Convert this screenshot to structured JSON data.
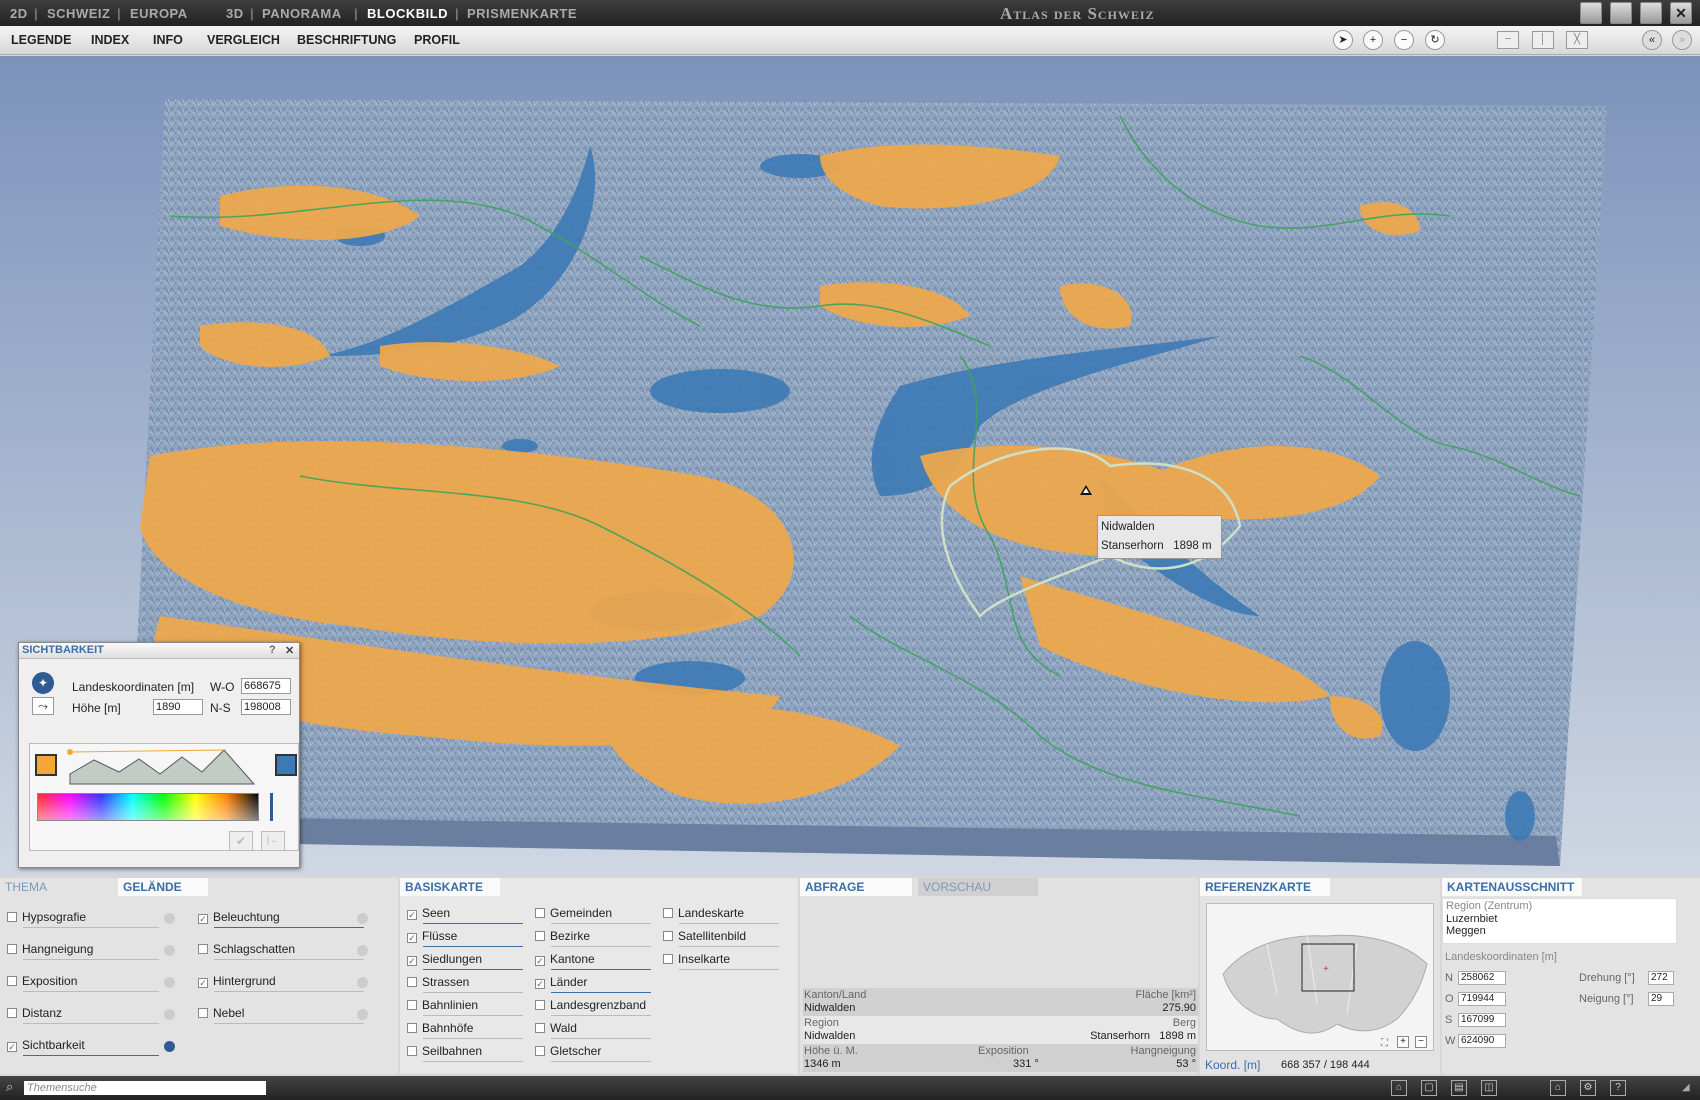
{
  "nav": {
    "t2d": "2D",
    "schweiz": "SCHWEIZ",
    "europa": "EUROPA",
    "t3d": "3D",
    "panorama": "PANORAMA",
    "blockbild": "BLOCKBILD",
    "prismenkarte": "PRISMENKARTE"
  },
  "app_title": "Atlas der Schweiz",
  "menu": {
    "legende": "LEGENDE",
    "index": "INDEX",
    "info": "INFO",
    "vergleich": "VERGLEICH",
    "beschriftung": "BESCHRIFTUNG",
    "profil": "PROFIL"
  },
  "map": {
    "tooltip_region": "Nidwalden",
    "tooltip_peak": "Stanserhorn",
    "tooltip_height": "1898 m"
  },
  "sicht": {
    "title": "SICHTBARKEIT",
    "help": "?",
    "close": "✕",
    "landeskoord_label": "Landeskoordinaten [m]",
    "wo_label": "W-O",
    "wo_value": "668675",
    "hoehe_label": "Höhe [m]",
    "hoehe_value": "1890",
    "ns_label": "N-S",
    "ns_value": "198008",
    "color_visible": "#f4a636",
    "color_hidden": "#3d7ab5"
  },
  "thema": {
    "tab_thema": "THEMA",
    "tab_gelaende": "GELÄNDE",
    "left": [
      {
        "label": "Hypsografie",
        "checked": false
      },
      {
        "label": "Hangneigung",
        "checked": false
      },
      {
        "label": "Exposition",
        "checked": false
      },
      {
        "label": "Distanz",
        "checked": false
      },
      {
        "label": "Sichtbarkeit",
        "checked": true
      }
    ],
    "right": [
      {
        "label": "Beleuchtung",
        "checked": true
      },
      {
        "label": "Schlagschatten",
        "checked": false
      },
      {
        "label": "Hintergrund",
        "checked": true
      },
      {
        "label": "Nebel",
        "checked": false
      }
    ]
  },
  "basis": {
    "title": "BASISKARTE",
    "col1": [
      {
        "label": "Seen",
        "checked": true
      },
      {
        "label": "Flüsse",
        "checked": true
      },
      {
        "label": "Siedlungen",
        "checked": true
      },
      {
        "label": "Strassen",
        "checked": false
      },
      {
        "label": "Bahnlinien",
        "checked": false
      },
      {
        "label": "Bahnhöfe",
        "checked": false
      },
      {
        "label": "Seilbahnen",
        "checked": false
      }
    ],
    "col2": [
      {
        "label": "Gemeinden",
        "checked": false
      },
      {
        "label": "Bezirke",
        "checked": false
      },
      {
        "label": "Kantone",
        "checked": true
      },
      {
        "label": "Länder",
        "checked": true
      },
      {
        "label": "Landesgrenzband",
        "checked": false
      },
      {
        "label": "Wald",
        "checked": false
      },
      {
        "label": "Gletscher",
        "checked": false
      }
    ],
    "col3": [
      {
        "label": "Landeskarte",
        "checked": false
      },
      {
        "label": "Satellitenbild",
        "checked": false
      },
      {
        "label": "Inselkarte",
        "checked": false
      }
    ]
  },
  "abfrage": {
    "tab": "ABFRAGE",
    "tab2": "VORSCHAU",
    "kanton_label": "Kanton/Land",
    "kanton_value": "Nidwalden",
    "flaeche_label": "Fläche [km²]",
    "flaeche_value": "275.90",
    "region_label": "Region",
    "region_value": "Nidwalden",
    "berg_label": "Berg",
    "berg_value": "Stanserhorn",
    "berg_hoehe": "1898 m",
    "hoehe_label": "Höhe ü. M.",
    "hoehe_value": "1346 m",
    "expo_label": "Exposition",
    "expo_value": "331 °",
    "hang_label": "Hangneigung",
    "hang_value": "53 °"
  },
  "referenz": {
    "title": "REFERENZKARTE",
    "koord_label": "Koord. [m]",
    "koord_value": "668 357 / 198 444"
  },
  "ausschnitt": {
    "title": "KARTENAUSSCHNITT",
    "region_label": "Region (Zentrum)",
    "region1": "Luzernbiet",
    "region2": "Meggen",
    "koord_label": "Landeskoordinaten [m]",
    "n_label": "N",
    "n_value": "258062",
    "o_label": "O",
    "o_value": "719944",
    "s_label": "S",
    "s_value": "167099",
    "w_label": "W",
    "w_value": "624090",
    "drehung_label": "Drehung [°]",
    "drehung_value": "272",
    "neigung_label": "Neigung [°]",
    "neigung_value": "29"
  },
  "bottom": {
    "search_placeholder": "Themensuche"
  }
}
